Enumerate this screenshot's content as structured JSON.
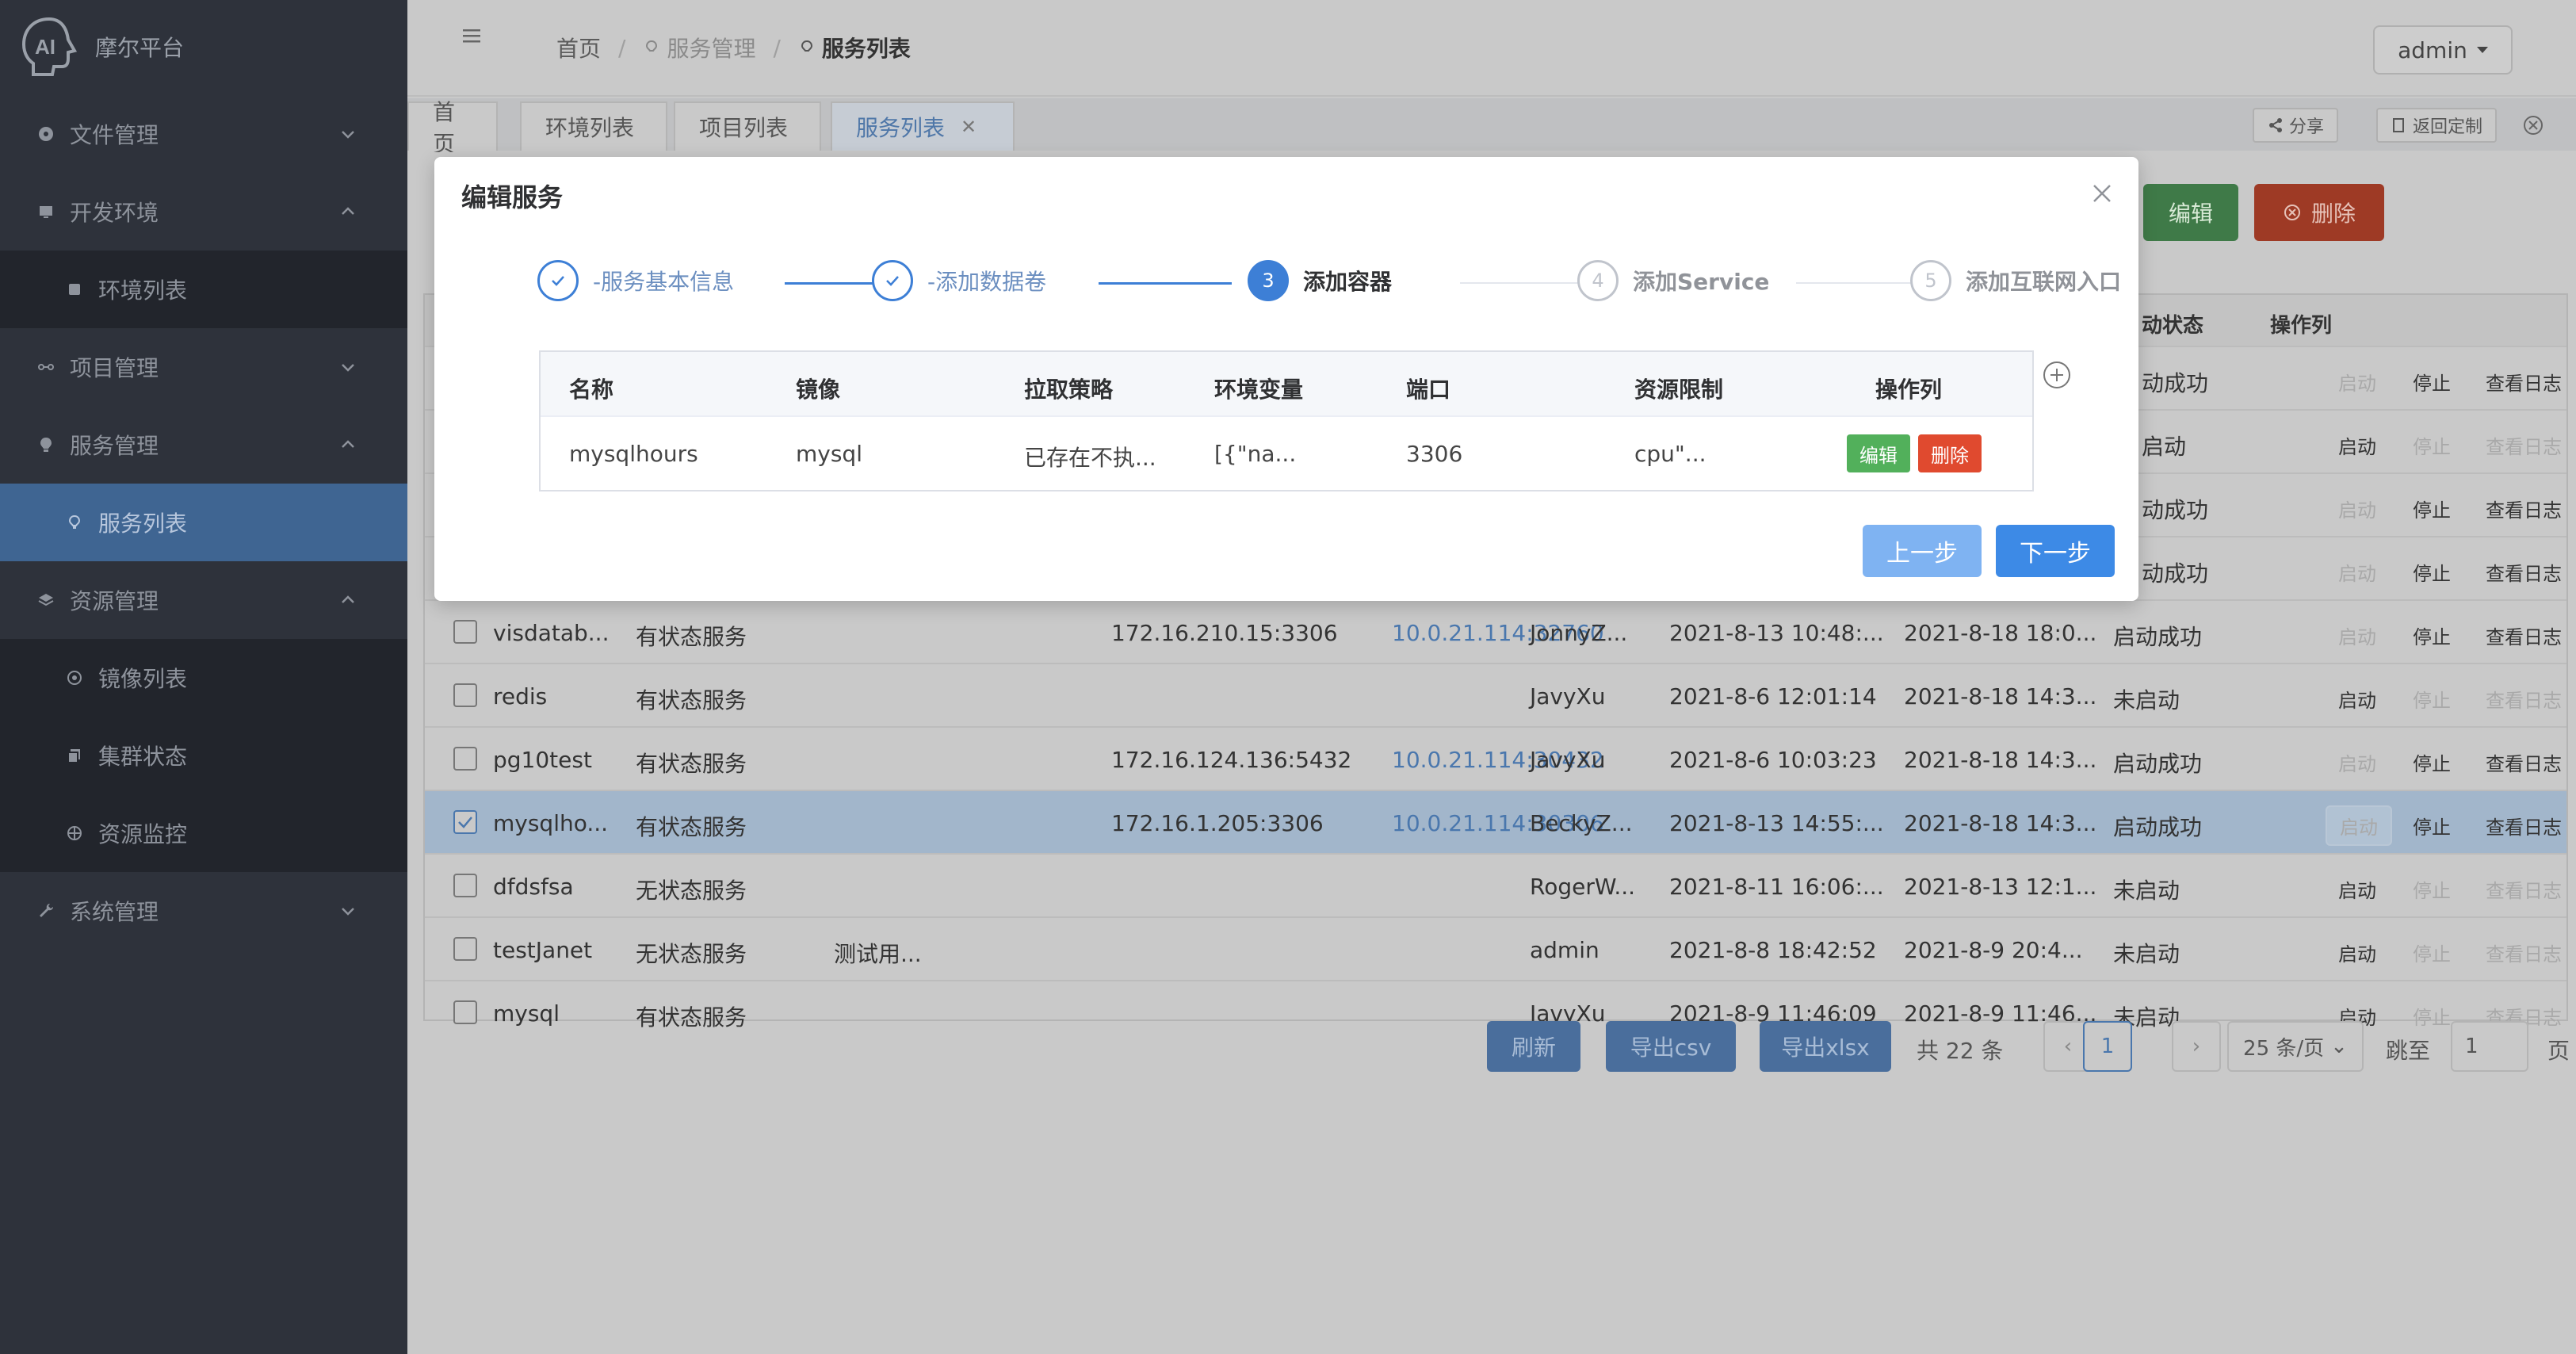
{
  "app": {
    "name": "摩尔平台"
  },
  "sidebar": {
    "items": [
      {
        "label": "文件管理",
        "icon": "gear-icon",
        "arrow": "down"
      },
      {
        "label": "开发环境",
        "icon": "monitor-icon",
        "arrow": "up"
      },
      {
        "label": "环境列表",
        "icon": "list-icon",
        "sub": true
      },
      {
        "label": "项目管理",
        "icon": "share-icon",
        "arrow": "down"
      },
      {
        "label": "服务管理",
        "icon": "bulb-icon",
        "arrow": "up"
      },
      {
        "label": "服务列表",
        "icon": "bulb-icon",
        "sub": true,
        "active": true
      },
      {
        "label": "资源管理",
        "icon": "layers-icon",
        "arrow": "up"
      },
      {
        "label": "镜像列表",
        "icon": "circle-icon",
        "sub": true
      },
      {
        "label": "集群状态",
        "icon": "copy-icon",
        "sub": true
      },
      {
        "label": "资源监控",
        "icon": "aperture-icon",
        "sub": true
      },
      {
        "label": "系统管理",
        "icon": "wrench-icon",
        "arrow": "down"
      }
    ]
  },
  "header": {
    "breadcrumb": [
      "首页",
      "服务管理",
      "服务列表"
    ],
    "user": "admin"
  },
  "tabs": {
    "items": [
      "首页",
      "环境列表",
      "项目列表",
      "服务列表"
    ],
    "share": "分享",
    "back_custom": "返回定制"
  },
  "toolbar": {
    "edit": "编辑",
    "delete": "删除"
  },
  "table": {
    "headers": {
      "run_status": "动状态",
      "ops": "操作列"
    },
    "ops": {
      "start": "启动",
      "stop": "停止",
      "log": "查看日志"
    },
    "rows": [
      {
        "status_partial": "动成功"
      },
      {
        "status_partial": "启动"
      },
      {
        "status_partial": "动成功"
      },
      {
        "status_partial": "动成功"
      },
      {
        "name": "visdatab...",
        "type": "有状态服务",
        "desc": "",
        "inner": "172.16.210.15:3306",
        "outer": "10.0.21.114:32760",
        "owner": "JonnyZ...",
        "created": "2021-8-13 10:48:...",
        "updated": "2021-8-18 18:0...",
        "status": "启动成功"
      },
      {
        "name": "redis",
        "type": "有状态服务",
        "desc": "",
        "inner": "",
        "outer": "",
        "owner": "JavyXu",
        "created": "2021-8-6 12:01:14",
        "updated": "2021-8-18 14:3...",
        "status": "未启动"
      },
      {
        "name": "pg10test",
        "type": "有状态服务",
        "desc": "",
        "inner": "172.16.124.136:5432",
        "outer": "10.0.21.114:30432",
        "owner": "JavyXu",
        "created": "2021-8-6 10:03:23",
        "updated": "2021-8-18 14:3...",
        "status": "启动成功"
      },
      {
        "name": "mysqlho...",
        "type": "有状态服务",
        "desc": "",
        "inner": "172.16.1.205:3306",
        "outer": "10.0.21.114:30306",
        "owner": "BeckyZ...",
        "created": "2021-8-13 14:55:...",
        "updated": "2021-8-18 14:3...",
        "status": "启动成功"
      },
      {
        "name": "dfdsfsa",
        "type": "无状态服务",
        "desc": "",
        "inner": "",
        "outer": "",
        "owner": "RogerW...",
        "created": "2021-8-11 16:06:...",
        "updated": "2021-8-13 12:1...",
        "status": "未启动"
      },
      {
        "name": "testJanet",
        "type": "无状态服务",
        "desc": "测试用...",
        "inner": "",
        "outer": "",
        "owner": "admin",
        "created": "2021-8-8 18:42:52",
        "updated": "2021-8-9 20:4...",
        "status": "未启动"
      },
      {
        "name": "mysql",
        "type": "有状态服务",
        "desc": "",
        "inner": "",
        "outer": "",
        "owner": "JavyXu",
        "created": "2021-8-9 11:46:09",
        "updated": "2021-8-9 11:46...",
        "status": "未启动"
      }
    ]
  },
  "pager": {
    "refresh": "刷新",
    "export_csv": "导出csv",
    "export_xlsx": "导出xlsx",
    "total": "共 22 条",
    "current_page": "1",
    "page_size": "25 条/页",
    "goto_label": "跳至",
    "goto_value": "1",
    "page_suffix": "页"
  },
  "modal": {
    "title": "编辑服务",
    "steps": [
      {
        "label": "-服务基本信息",
        "state": "done"
      },
      {
        "label": "-添加数据卷",
        "state": "done"
      },
      {
        "num": "3",
        "label": "添加容器",
        "state": "active"
      },
      {
        "num": "4",
        "label": "添加Service",
        "state": "wait"
      },
      {
        "num": "5",
        "label": "添加互联网入口",
        "state": "wait"
      }
    ],
    "table": {
      "headers": [
        "名称",
        "镜像",
        "拉取策略",
        "环境变量",
        "端口",
        "资源限制",
        "操作列"
      ],
      "row": {
        "name": "mysqlhours",
        "image": "mysql",
        "pull_policy": "已存在不执...",
        "env": "[{\"na...",
        "port": "3306",
        "resources": "cpu\"...",
        "edit": "编辑",
        "delete": "删除"
      }
    },
    "prev": "上一步",
    "next": "下一步"
  },
  "colors": {
    "sidebar_bg": "#2e323b",
    "primary": "#3d8ae6",
    "success": "#52b05b",
    "danger": "#e04a2f"
  }
}
